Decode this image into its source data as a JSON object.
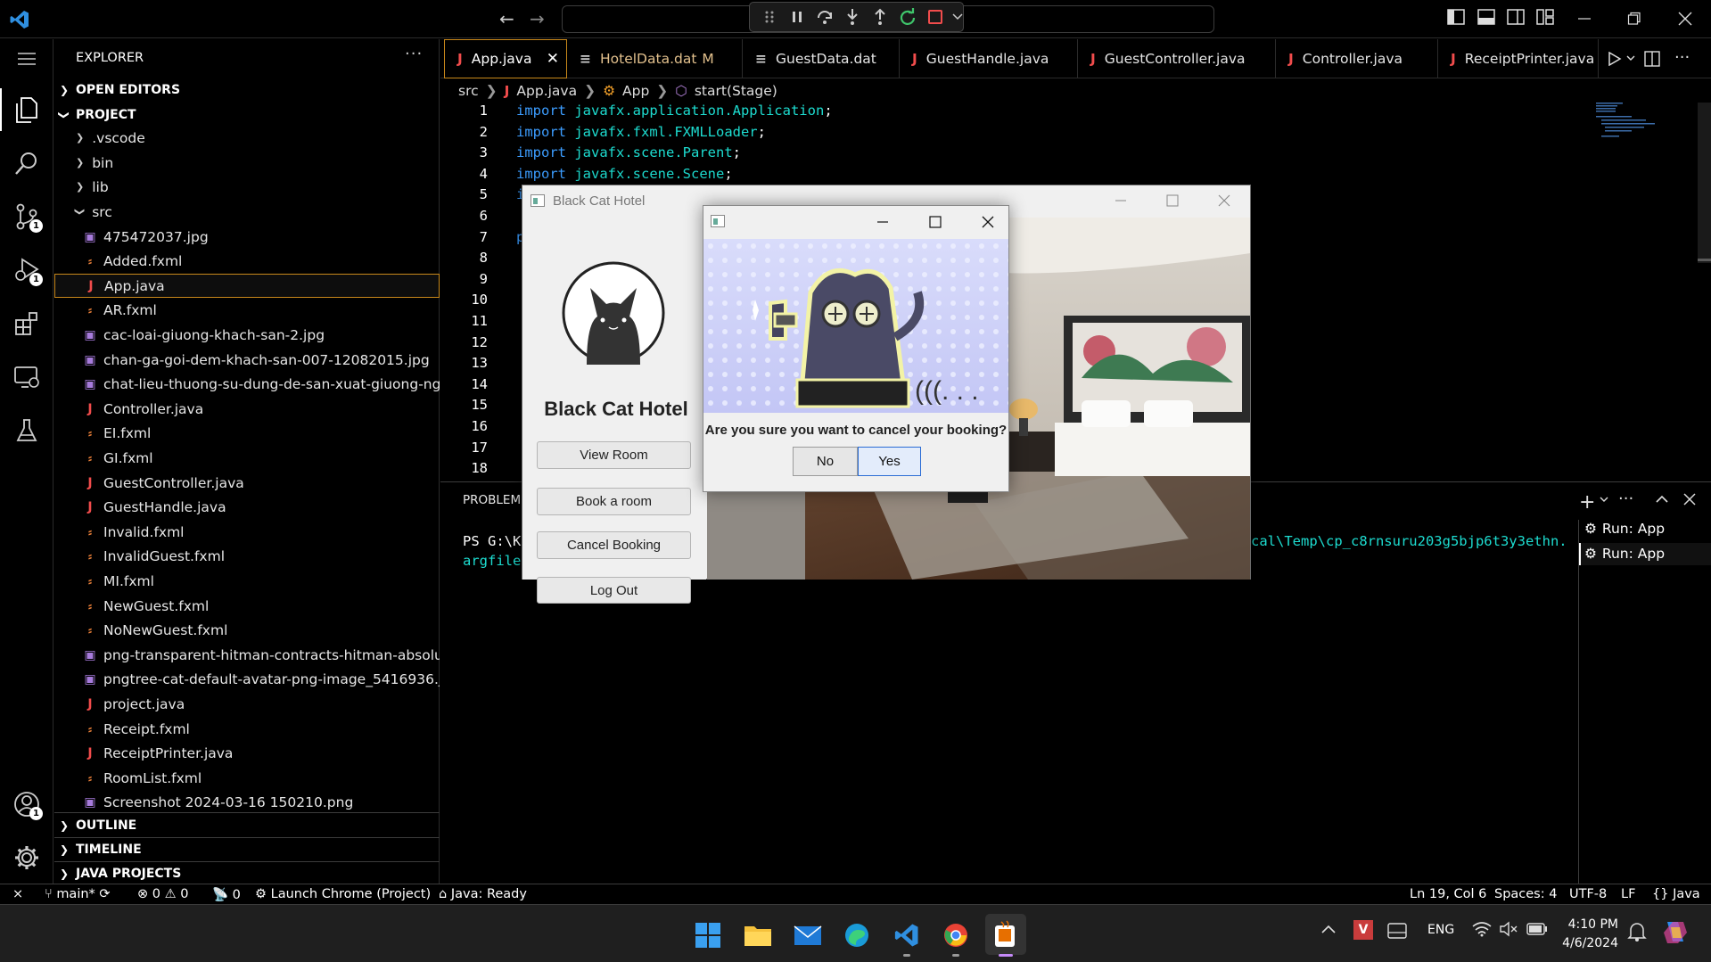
{
  "titlebar": {
    "command_center_placeholder": ""
  },
  "explorer": {
    "title": "EXPLORER",
    "sections": {
      "open_editors": "OPEN EDITORS",
      "project": "PROJECT",
      "outline": "OUTLINE",
      "timeline": "TIMELINE",
      "java_projects": "JAVA PROJECTS"
    },
    "folders": [
      ".vscode",
      "bin",
      "lib",
      "src"
    ],
    "files": [
      {
        "name": "475472037.jpg",
        "type": "image"
      },
      {
        "name": "Added.fxml",
        "type": "xml"
      },
      {
        "name": "App.java",
        "type": "java"
      },
      {
        "name": "AR.fxml",
        "type": "xml"
      },
      {
        "name": "cac-loai-giuong-khach-san-2.jpg",
        "type": "image"
      },
      {
        "name": "chan-ga-goi-dem-khach-san-007-12082015.jpg",
        "type": "image"
      },
      {
        "name": "chat-lieu-thuong-su-dung-de-san-xuat-giuong-ng...",
        "type": "image"
      },
      {
        "name": "Controller.java",
        "type": "java"
      },
      {
        "name": "EI.fxml",
        "type": "xml"
      },
      {
        "name": "GI.fxml",
        "type": "xml"
      },
      {
        "name": "GuestController.java",
        "type": "java"
      },
      {
        "name": "GuestHandle.java",
        "type": "java"
      },
      {
        "name": "Invalid.fxml",
        "type": "xml"
      },
      {
        "name": "InvalidGuest.fxml",
        "type": "xml"
      },
      {
        "name": "MI.fxml",
        "type": "xml"
      },
      {
        "name": "NewGuest.fxml",
        "type": "xml"
      },
      {
        "name": "NoNewGuest.fxml",
        "type": "xml"
      },
      {
        "name": "png-transparent-hitman-contracts-hitman-absoluti...",
        "type": "image"
      },
      {
        "name": "pngtree-cat-default-avatar-png-image_5416936.jpg",
        "type": "image"
      },
      {
        "name": "project.java",
        "type": "java"
      },
      {
        "name": "Receipt.fxml",
        "type": "xml"
      },
      {
        "name": "ReceiptPrinter.java",
        "type": "java"
      },
      {
        "name": "RoomList.fxml",
        "type": "xml"
      },
      {
        "name": "Screenshot 2024-03-16 150210.png",
        "type": "image"
      }
    ]
  },
  "tabs": [
    {
      "label": "App.java",
      "icon": "J"
    },
    {
      "label": "HotelData.dat",
      "icon": "≡",
      "status": "M"
    },
    {
      "label": "GuestData.dat",
      "icon": "≡"
    },
    {
      "label": "GuestHandle.java",
      "icon": "J"
    },
    {
      "label": "GuestController.java",
      "icon": "J"
    },
    {
      "label": "Controller.java",
      "icon": "J"
    },
    {
      "label": "ReceiptPrinter.java",
      "icon": "J"
    }
  ],
  "breadcrumb": {
    "p1": "src",
    "p2": "App.java",
    "p3": "App",
    "p4": "start(Stage)"
  },
  "code": [
    {
      "n": "1",
      "kw": "import",
      "pk": "javafx.application.Application",
      "end": ";"
    },
    {
      "n": "2",
      "kw": "import",
      "pk": "javafx.fxml.FXMLLoader",
      "end": ";"
    },
    {
      "n": "3",
      "kw": "import",
      "pk": "javafx.scene.Parent",
      "end": ";"
    },
    {
      "n": "4",
      "kw": "import",
      "pk": "javafx.scene.Scene",
      "end": ";"
    },
    {
      "n": "5",
      "kw": "i",
      "pk": "",
      "end": ""
    },
    {
      "n": "6",
      "kw": "",
      "pk": "",
      "end": ""
    },
    {
      "n": "7",
      "kw": "p",
      "pk": "",
      "end": ""
    },
    {
      "n": "8",
      "kw": "",
      "pk": "",
      "end": ""
    },
    {
      "n": "9",
      "kw": "",
      "pk": "",
      "end": ""
    },
    {
      "n": "10",
      "kw": "",
      "pk": "",
      "end": ""
    },
    {
      "n": "11",
      "kw": "",
      "pk": "",
      "end": ""
    },
    {
      "n": "12",
      "kw": "",
      "pk": "",
      "end": ""
    },
    {
      "n": "13",
      "kw": "",
      "pk": "",
      "end": ""
    },
    {
      "n": "14",
      "kw": "",
      "pk": "",
      "end": ""
    },
    {
      "n": "15",
      "kw": "",
      "pk": "",
      "end": ""
    },
    {
      "n": "16",
      "kw": "",
      "pk": "",
      "end": ""
    },
    {
      "n": "17",
      "kw": "",
      "pk": "",
      "end": ""
    },
    {
      "n": "18",
      "kw": "",
      "pk": "",
      "end": ""
    }
  ],
  "panel": {
    "tab": "PROBLEMS",
    "term_prompt": "PS G:\\KU",
    "term_argfile": "argfile",
    "term_path": "cal\\Temp\\cp_c8rnsuru203g5bjp6t3y3ethn.",
    "runs": [
      "Run: App",
      "Run: App"
    ]
  },
  "status": {
    "branch": "main*",
    "errors": "0",
    "warnings": "0",
    "ports": "0",
    "launch": "Launch Chrome (Project)",
    "java": "Java: Ready",
    "position": "Ln 19, Col 6",
    "spaces": "Spaces: 4",
    "encoding": "UTF-8",
    "eol": "LF",
    "language": "Java"
  },
  "app": {
    "title": "Black Cat Hotel",
    "hotel_name": "Black Cat Hotel",
    "buttons": [
      "View Room",
      "Book a room",
      "Cancel Booking",
      "Log Out"
    ]
  },
  "dialog": {
    "message": "Are you sure you want to cancel your booking?",
    "no": "No",
    "yes": "Yes"
  },
  "taskbar": {
    "lang": "ENG",
    "time": "4:10 PM",
    "date": "4/6/2024"
  },
  "colors": {
    "accent": "#c8881b",
    "keyword": "#3c9dff",
    "package": "#1ddcd0",
    "java_icon": "#f14c4c"
  }
}
